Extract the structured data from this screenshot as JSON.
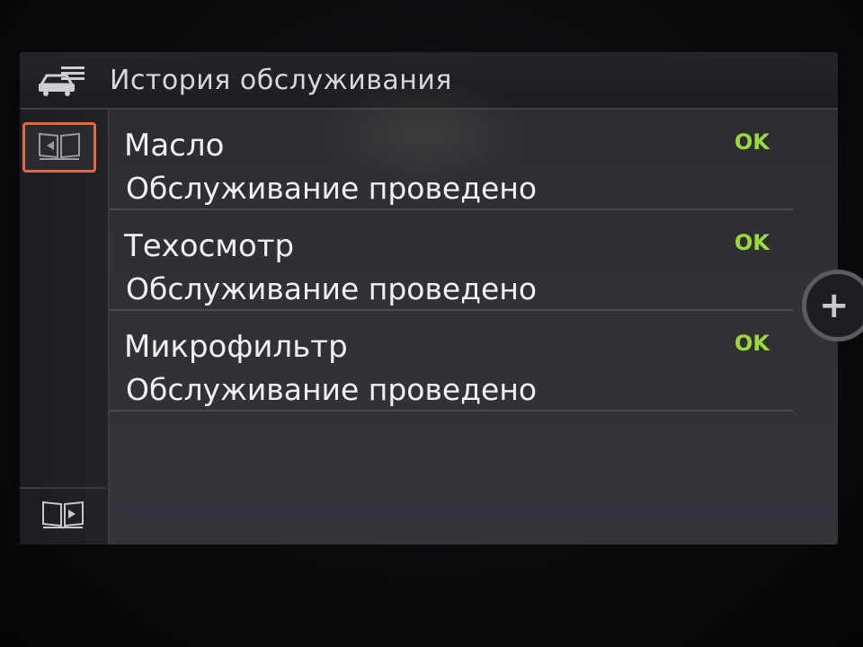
{
  "header": {
    "title": "История обслуживания",
    "icon": "car-service-icon"
  },
  "sidebar": {
    "top_button_icon": "book-back-icon",
    "bottom_button_icon": "book-forward-icon"
  },
  "items": [
    {
      "name": "Масло",
      "status": "Обслуживание проведено",
      "badge": "OK"
    },
    {
      "name": "Техосмотр",
      "status": "Обслуживание проведено",
      "badge": "OK"
    },
    {
      "name": "Микрофильтр",
      "status": "Обслуживание проведено",
      "badge": "OK"
    }
  ],
  "controls": {
    "zoom_symbol": "+"
  },
  "colors": {
    "accent_ok": "#9bd83a",
    "selection": "#e06a3c",
    "text": "#f1f1f2"
  }
}
